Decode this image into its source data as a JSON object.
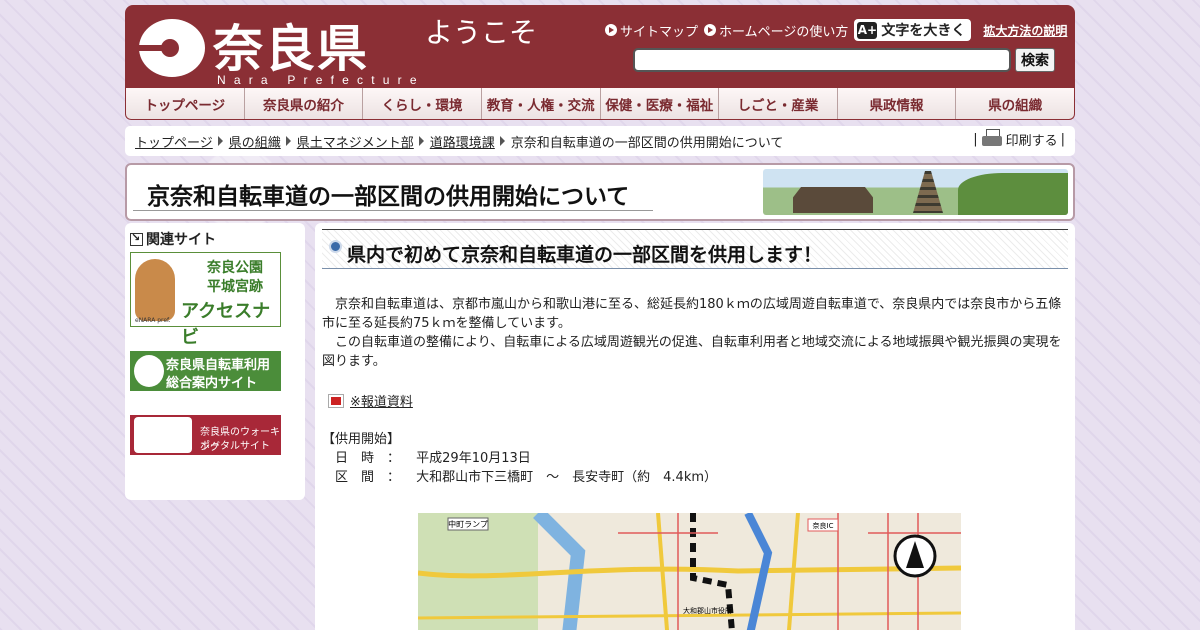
{
  "header": {
    "logo_kanji": "奈良県",
    "logo_roman": "Nara Prefecture",
    "welcome": "ようこそ",
    "links": [
      "サイトマップ",
      "ホームページの使い方"
    ],
    "big_text_icon": "A+",
    "big_text_label": "文字を大きく",
    "zoom_help": "拡大方法の説明",
    "search_value": "",
    "search_button": "検索"
  },
  "nav": [
    "トップページ",
    "奈良県の紹介",
    "くらし・環境",
    "教育・人権・交流",
    "保健・医療・福祉",
    "しごと・産業",
    "県政情報",
    "県の組織"
  ],
  "breadcrumb": {
    "items": [
      "トップページ",
      "県の組織",
      "県土マネジメント部",
      "道路環境課"
    ],
    "current": "京奈和自転車道の一部区間の供用開始について",
    "print_prefix": "|",
    "print_label": "印刷する",
    "print_suffix": "|"
  },
  "page_title": "京奈和自転車道の一部区間の供用開始について",
  "sidebar": {
    "heading": "関連サイト",
    "banner1": {
      "line1": "奈良公園",
      "line2": "平城宮跡",
      "line3": "アクセスナビ",
      "small": "eNARA pref."
    },
    "banner2": {
      "line1": "奈良県自転車利用",
      "line2": "総合案内サイト"
    },
    "banner3": {
      "line1": "奈良県のウォーキング",
      "line2": "ポータルサイト"
    }
  },
  "main": {
    "heading": "県内で初めて京奈和自転車道の一部区間を供用します！",
    "para1": "　京奈和自転車道は、京都市嵐山から和歌山港に至る、総延長約180ｋｍの広域周遊自転車道で、奈良県内では奈良市から五條市に至る延長約75ｋｍを整備しています。",
    "para2": "　この自転車道の整備により、自転車による広域周遊観光の促進、自転車利用者と地域交流による地域振興や観光振興の実現を図ります。",
    "pdf_link": "※報道資料",
    "service_heading": "【供用開始】",
    "date_label": "　日　時　：",
    "date_value": "平成29年10月13日",
    "section_label": "　区　間　：",
    "section_value": "大和郡山市下三橋町　～　長安寺町（約　4.4km）",
    "map_labels": [
      "中町ランプ",
      "大和郡山市役所",
      "奈良IC"
    ]
  }
}
